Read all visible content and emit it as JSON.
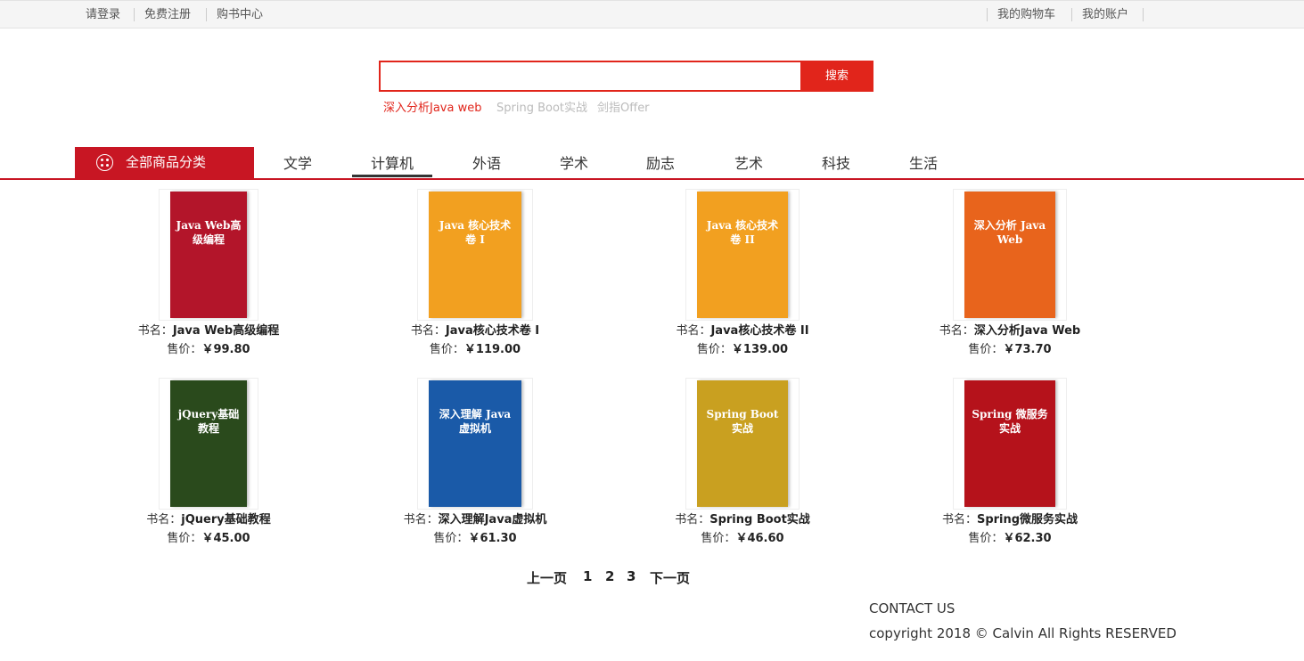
{
  "topbar": {
    "login": "请登录",
    "register": "免费注册",
    "bookcenter": "购书中心",
    "cart": "我的购物车",
    "account": "我的账户"
  },
  "search": {
    "value": "",
    "placeholder": "",
    "button": "搜索",
    "hot": [
      "深入分析Java web",
      "Spring Boot实战",
      "剑指Offer"
    ]
  },
  "nav": {
    "all_label": "全部商品分类",
    "items": [
      "文学",
      "计算机",
      "外语",
      "学术",
      "励志",
      "艺术",
      "科技",
      "生活"
    ],
    "active": "计算机"
  },
  "labels": {
    "name_prefix": "书名：",
    "price_prefix": "售价：",
    "currency": "￥"
  },
  "books": [
    {
      "name": "Java Web高级编程",
      "price": "99.80",
      "cover_text": "Java Web高级编程",
      "cover_color": "#b3152a"
    },
    {
      "name": "Java核心技术卷 I",
      "price": "119.00",
      "cover_text": "Java 核心技术 卷 I",
      "cover_color": "#f2a020"
    },
    {
      "name": "Java核心技术卷 II",
      "price": "139.00",
      "cover_text": "Java 核心技术 卷 II",
      "cover_color": "#f2a020"
    },
    {
      "name": "深入分析Java Web",
      "price": "73.70",
      "cover_text": "深入分析 Java Web",
      "cover_color": "#e8641c"
    },
    {
      "name": "jQuery基础教程",
      "price": "45.00",
      "cover_text": "jQuery基础教程",
      "cover_color": "#2a4a1c"
    },
    {
      "name": "深入理解Java虚拟机",
      "price": "61.30",
      "cover_text": "深入理解 Java 虚拟机",
      "cover_color": "#1a5aa8"
    },
    {
      "name": "Spring Boot实战",
      "price": "46.60",
      "cover_text": "Spring Boot 实战",
      "cover_color": "#c9a020"
    },
    {
      "name": "Spring微服务实战",
      "price": "62.30",
      "cover_text": "Spring 微服务实战",
      "cover_color": "#b5121b"
    }
  ],
  "pager": {
    "prev": "上一页",
    "pages": [
      "1",
      "2",
      "3"
    ],
    "next": "下一页"
  },
  "footer": {
    "contact": "CONTACT US",
    "copyright": "copyright 2018 © Calvin All Rights RESERVED"
  }
}
